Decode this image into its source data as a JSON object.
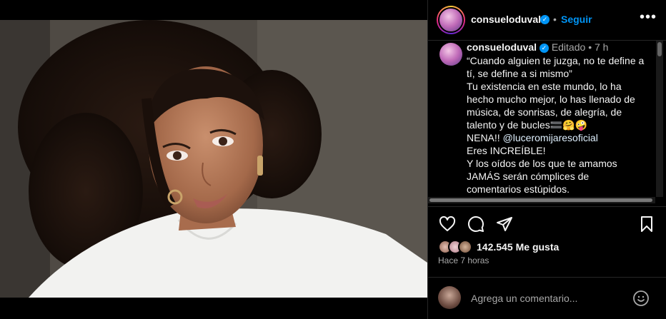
{
  "post": {
    "username": "consueloduval",
    "follow_label": "Seguir",
    "dot": "•",
    "more": "•••"
  },
  "caption": {
    "username": "consueloduval",
    "edited_label": "Editado",
    "separator": "•",
    "age": "7 h",
    "lines": [
      "“Cuando alguien te juzga, no te define a",
      "tí, se define a si mismo”",
      "Tu existencia en este mundo, lo ha",
      "hecho mucho mejor, lo has llenado de",
      "música, de sonrisas, de alegría, de",
      "talento y de bucles",
      "NENA!! ",
      "Eres INCREÍBLE!",
      "Y los oídos de los que te amamos",
      "JAMÁS serán cómplices de",
      "comentarios estúpidos."
    ],
    "emojis_line6": "🟰🤗🤪",
    "mention": "@luceromijaresoficial"
  },
  "likes": {
    "count": "142.545",
    "label": "Me gusta"
  },
  "timestamp": "Hace 7 horas",
  "comment": {
    "placeholder": "Agrega un comentario..."
  },
  "icons": [
    "verified-badge-icon",
    "more-icon",
    "heart-icon",
    "comment-icon",
    "share-icon",
    "bookmark-icon",
    "emoji-icon"
  ],
  "colors": {
    "accent": "#0095f6",
    "background": "#000000",
    "text_secondary": "#a8a8a8"
  }
}
